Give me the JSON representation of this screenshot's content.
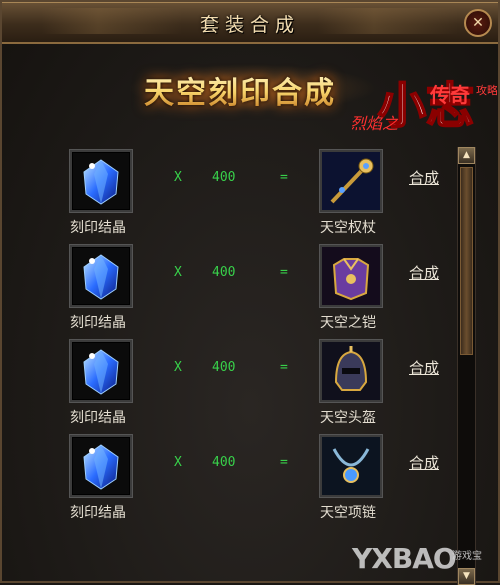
{
  "window": {
    "title": "套装合成",
    "close_label": "✕"
  },
  "banner": {
    "heading": "天空刻印合成"
  },
  "watermark": {
    "logo_big": "小志",
    "logo_small": "烈焰之",
    "logo_top": "传奇",
    "logo_tag": "攻略",
    "bottom_text": "YXBAO",
    "bottom_small": "游戏宝"
  },
  "rows": [
    {
      "material": "刻印结晶",
      "mult": "X",
      "qty": "400",
      "eq": "=",
      "result": "天空权杖",
      "result_icon": "scepter-icon",
      "action": "合成"
    },
    {
      "material": "刻印结晶",
      "mult": "X",
      "qty": "400",
      "eq": "=",
      "result": "天空之铠",
      "result_icon": "armor-icon",
      "action": "合成"
    },
    {
      "material": "刻印结晶",
      "mult": "X",
      "qty": "400",
      "eq": "=",
      "result": "天空头盔",
      "result_icon": "helmet-icon",
      "action": "合成"
    },
    {
      "material": "刻印结晶",
      "mult": "X",
      "qty": "400",
      "eq": "=",
      "result": "天空项链",
      "result_icon": "necklace-icon",
      "action": "合成"
    }
  ],
  "scroll": {
    "up_glyph": "▲",
    "down_glyph": "▼",
    "position": 0.0
  },
  "colors": {
    "accent_green": "#38d04a",
    "title_gold": "#f2dcb0",
    "frame_brown": "#5a4630"
  }
}
